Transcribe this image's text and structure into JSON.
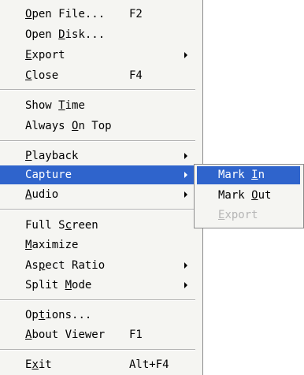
{
  "main_menu": {
    "items": [
      {
        "label_prefix": "",
        "accel": "O",
        "label_suffix": "pen File...",
        "shortcut": "F2"
      },
      {
        "label_prefix": "Open ",
        "accel": "D",
        "label_suffix": "isk...",
        "shortcut": ""
      },
      {
        "label_prefix": "",
        "accel": "E",
        "label_suffix": "xport",
        "shortcut": ""
      },
      {
        "label_prefix": "",
        "accel": "C",
        "label_suffix": "lose",
        "shortcut": "F4"
      },
      {
        "label_prefix": "Show ",
        "accel": "T",
        "label_suffix": "ime",
        "shortcut": ""
      },
      {
        "label_prefix": "Always ",
        "accel": "O",
        "label_suffix": "n Top",
        "shortcut": ""
      },
      {
        "label_prefix": "",
        "accel": "P",
        "label_suffix": "layback",
        "shortcut": ""
      },
      {
        "label_prefix": "",
        "accel": "C",
        "label_suffix": "apture",
        "shortcut": ""
      },
      {
        "label_prefix": "",
        "accel": "A",
        "label_suffix": "udio",
        "shortcut": ""
      },
      {
        "label_prefix": "Full S",
        "accel": "c",
        "label_suffix": "reen",
        "shortcut": ""
      },
      {
        "label_prefix": "",
        "accel": "M",
        "label_suffix": "aximize",
        "shortcut": ""
      },
      {
        "label_prefix": "As",
        "accel": "p",
        "label_suffix": "ect Ratio",
        "shortcut": ""
      },
      {
        "label_prefix": "Split ",
        "accel": "M",
        "label_suffix": "ode",
        "shortcut": ""
      },
      {
        "label_prefix": "Op",
        "accel": "t",
        "label_suffix": "ions...",
        "shortcut": ""
      },
      {
        "label_prefix": "",
        "accel": "A",
        "label_suffix": "bout Viewer",
        "shortcut": "F1"
      },
      {
        "label_prefix": "E",
        "accel": "x",
        "label_suffix": "it",
        "shortcut": "Alt+F4"
      }
    ],
    "selected_label": "Capture"
  },
  "capture_submenu": {
    "items": [
      {
        "label_prefix": "Mark ",
        "accel": "I",
        "label_suffix": "n",
        "state": "selected"
      },
      {
        "label_prefix": "Mark ",
        "accel": "O",
        "label_suffix": "ut",
        "state": "normal"
      },
      {
        "label_prefix": "",
        "accel": "E",
        "label_suffix": "xport",
        "state": "disabled"
      }
    ]
  },
  "colors": {
    "menu_background": "#f5f5f2",
    "selection_background": "#2f64cc",
    "selection_text": "#ffffff",
    "disabled_text": "#b5b5b5",
    "separator": "#b2b2b2"
  },
  "icons": {
    "submenu_arrow": "submenu-arrow-icon"
  }
}
